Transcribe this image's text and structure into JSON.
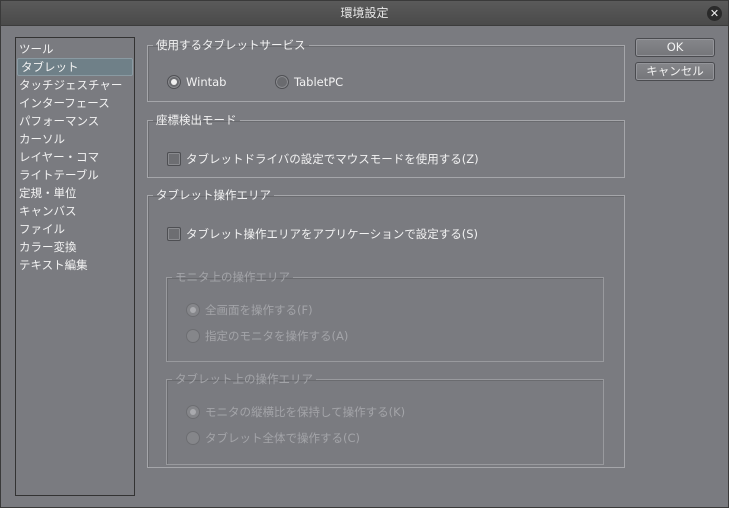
{
  "window": {
    "title": "環境設定",
    "close_icon": "close-icon"
  },
  "sidebar": {
    "items": [
      {
        "label": "ツール"
      },
      {
        "label": "タブレット",
        "selected": true
      },
      {
        "label": "タッチジェスチャー"
      },
      {
        "label": "インターフェース"
      },
      {
        "label": "パフォーマンス"
      },
      {
        "label": "カーソル"
      },
      {
        "label": "レイヤー・コマ"
      },
      {
        "label": "ライトテーブル"
      },
      {
        "label": "定規・単位"
      },
      {
        "label": "キャンバス"
      },
      {
        "label": "ファイル"
      },
      {
        "label": "カラー変換"
      },
      {
        "label": "テキスト編集"
      }
    ]
  },
  "tablet_service": {
    "legend": "使用するタブレットサービス",
    "options": [
      {
        "label": "Wintab",
        "checked": true
      },
      {
        "label": "TabletPC",
        "checked": false
      }
    ]
  },
  "coord_mode": {
    "legend": "座標検出モード",
    "checkbox": "タブレットドライバの設定でマウスモードを使用する(Z)",
    "checked": false
  },
  "tablet_area": {
    "legend": "タブレット操作エリア",
    "checkbox": "タブレット操作エリアをアプリケーションで設定する(S)",
    "checked": false,
    "monitor_area": {
      "legend": "モニタ上の操作エリア",
      "options": [
        {
          "label": "全画面を操作する(F)",
          "checked": true
        },
        {
          "label": "指定のモニタを操作する(A)",
          "checked": false
        }
      ]
    },
    "tablet_sub_area": {
      "legend": "タブレット上の操作エリア",
      "options": [
        {
          "label": "モニタの縦横比を保持して操作する(K)",
          "checked": true
        },
        {
          "label": "タブレット全体で操作する(C)",
          "checked": false
        }
      ]
    }
  },
  "buttons": {
    "ok": "OK",
    "cancel": "キャンセル"
  }
}
